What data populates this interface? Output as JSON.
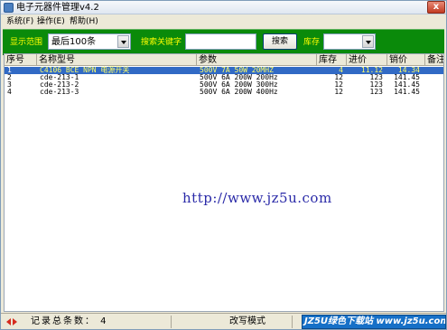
{
  "window": {
    "title": "电子元器件管理v4.2",
    "close_label": "x"
  },
  "menu": [
    {
      "label": "系统(F)"
    },
    {
      "label": "操作(E)"
    },
    {
      "label": "帮助(H)"
    }
  ],
  "toolbar": {
    "range_label": "显示范围",
    "range_value": "最后100条",
    "search_label": "搜索关键字",
    "search_value": "",
    "search_button": "搜索",
    "stock_label": "库存",
    "stock_value": ""
  },
  "grid": {
    "columns": [
      "序号",
      "名称型号",
      "参数",
      "库存",
      "进价",
      "销价",
      "备注"
    ],
    "rows": [
      {
        "no": "1",
        "name": "C4106 BCE NPN 电源开关",
        "params": "500V 7A 50W 20MHZ",
        "stock": "4",
        "cost": "11.12",
        "price": "14.34",
        "note": "",
        "selected": true
      },
      {
        "no": "2",
        "name": "cde-213-1",
        "params": "500V 6A 200W 200Hz",
        "stock": "12",
        "cost": "123",
        "price": "141.45",
        "note": "",
        "selected": false
      },
      {
        "no": "3",
        "name": "cde-213-2",
        "params": "500V 6A 200W 300Hz",
        "stock": "12",
        "cost": "123",
        "price": "141.45",
        "note": "",
        "selected": false
      },
      {
        "no": "4",
        "name": "cde-213-3",
        "params": "500V 6A 200W 400Hz",
        "stock": "12",
        "cost": "123",
        "price": "141.45",
        "note": "",
        "selected": false
      }
    ]
  },
  "watermark": "http://www.jz5u.com",
  "status": {
    "record_count": "记录总条数：  4",
    "mode": "改写模式",
    "badge": "JZ5U绿色下载站 www.jz5u.com"
  },
  "colors": {
    "toolbar_bg": "#0a8a0a",
    "toolbar_label": "#ffff00",
    "selection": "#316ac5",
    "watermark": "#2a2aa8",
    "badge_bg": "#1670c7"
  },
  "icons": {
    "app": "app-icon",
    "close": "close-icon",
    "dropdown": "chevron-down-icon",
    "status": "arrows-icon"
  }
}
